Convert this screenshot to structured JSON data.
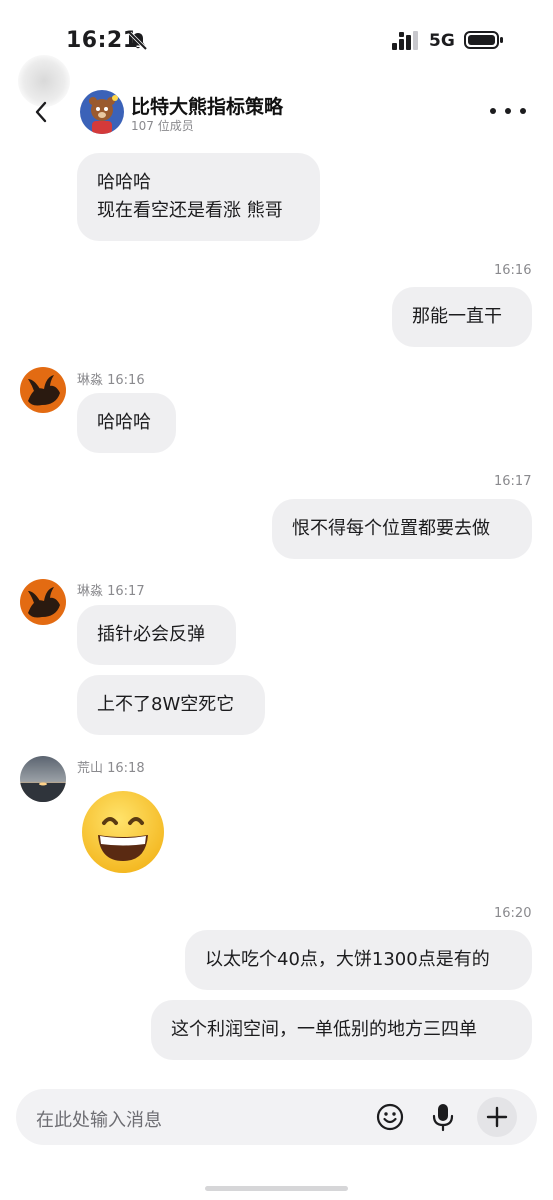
{
  "status_bar": {
    "time": "16:21",
    "network": "5G",
    "icons": [
      "bell-slash-icon",
      "signal-icon",
      "battery-icon"
    ]
  },
  "header": {
    "group_name": "比特大熊指标策略",
    "member_count": "107 位成员",
    "icons": [
      "chevron-left-icon",
      "more-icon"
    ]
  },
  "messages": {
    "m1_line1": "哈哈哈",
    "m1_line2": "现在看空还是看涨 熊哥",
    "time_1616": "16:16",
    "m2": "那能一直干",
    "sender_1": "琳淼 16:16",
    "m3": "哈哈哈",
    "time_1617": "16:17",
    "m4": "恨不得每个位置都要去做",
    "sender_2": "琳淼 16:17",
    "m5": "插针必会反弹",
    "m6": "上不了8W空死它",
    "sender_3": "荒山 16:18",
    "m7_emoji": "grinning-face-emoji",
    "time_1620": "16:20",
    "m8": "以太吃个40点，大饼1300点是有的",
    "m9": "这个利润空间，一单低别的地方三四单"
  },
  "input": {
    "placeholder": "在此处输入消息",
    "icons": [
      "emoji-icon",
      "microphone-icon",
      "plus-icon"
    ]
  },
  "colors": {
    "bubble": "#efeff1",
    "background": "#ffffff",
    "secondary_text": "#8a8a8e"
  }
}
